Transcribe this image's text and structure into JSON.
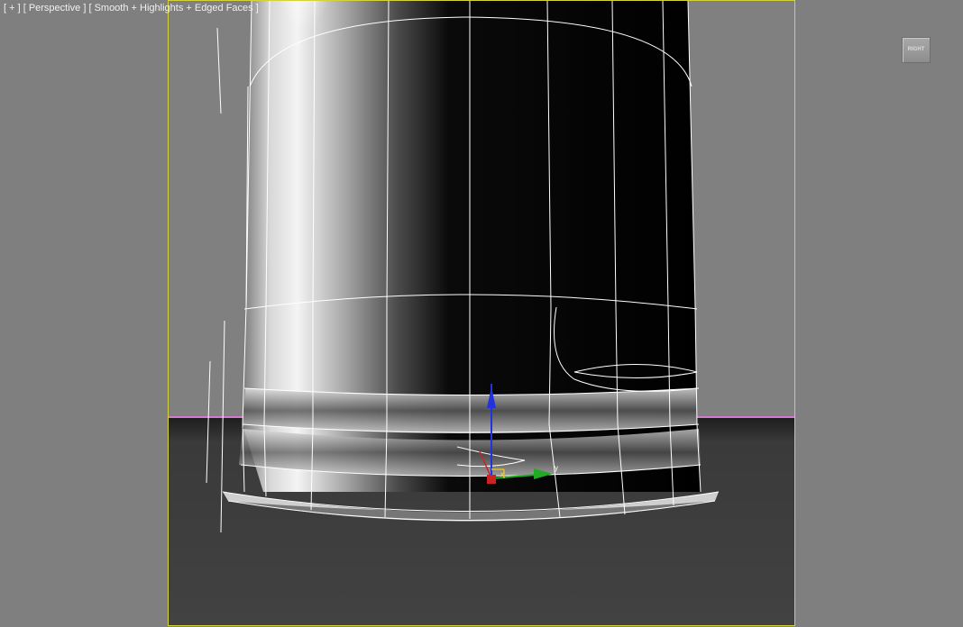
{
  "viewport": {
    "label": "[ + ] [ Perspective ] [ Smooth + Highlights + Edged Faces ]",
    "viewcube_face": "RIGHT",
    "gizmo_axis_x": "x",
    "gizmo_axis_y": "y"
  },
  "colors": {
    "viewport_bg": "#7f7f7f",
    "safe_frame": "#d6d23a",
    "ground": "#404040",
    "horizon_line": "#d37ad0",
    "wireframe": "#ffffff",
    "axis_x": "#cc2222",
    "axis_y": "#22aa22",
    "axis_z": "#2233dd"
  },
  "icons": [
    "viewcube-icon",
    "transform-gizmo-icon"
  ]
}
